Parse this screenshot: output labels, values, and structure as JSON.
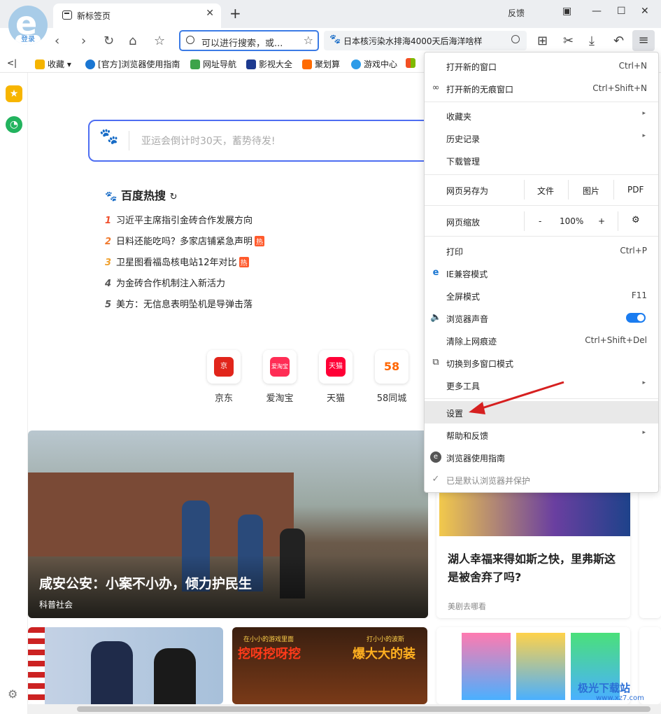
{
  "tab": {
    "title": "新标签页"
  },
  "window": {
    "feedback": "反馈",
    "close": "✕",
    "min": "—",
    "max": "☐"
  },
  "account": {
    "login": "登录"
  },
  "address": {
    "placeholder": "可以进行搜索，或..."
  },
  "search_suggest": {
    "text": "日本核污染水排海4000天后海洋啥样"
  },
  "bookmarks": {
    "collapse": "<|",
    "items": [
      "收藏",
      "[官方]浏览器使用指南",
      "网址导航",
      "影视大全",
      "聚划算",
      "游戏中心"
    ]
  },
  "baidu": {
    "placeholder": "亚运会倒计时30天，蓄势待发!",
    "hot_title": "百度热搜",
    "hot_items": [
      {
        "rank": "1",
        "text": "习近平主席指引金砖合作发展方向",
        "tag": ""
      },
      {
        "rank": "2",
        "text": "日料还能吃吗？多家店铺紧急声明",
        "tag": "热"
      },
      {
        "rank": "3",
        "text": "卫星图看福岛核电站12年对比",
        "tag": "热"
      },
      {
        "rank": "4",
        "text": "为金砖合作机制注入新活力",
        "tag": ""
      },
      {
        "rank": "5",
        "text": "美方：无信息表明坠机是导弹击落",
        "tag": ""
      }
    ]
  },
  "apps": [
    {
      "label": "京东",
      "color": "#e1251b",
      "glyph": "京"
    },
    {
      "label": "爱淘宝",
      "color": "#ff2d55",
      "glyph": "爱淘宝"
    },
    {
      "label": "天猫",
      "color": "#ff0036",
      "glyph": "天猫"
    },
    {
      "label": "58同城",
      "color": "#ffffff",
      "glyph": "58"
    }
  ],
  "news": {
    "main_title": "咸安公安：小案不小办，倾力护民生",
    "main_source": "科普社会",
    "side_title": "湖人幸福来得如斯之快，里弗斯这是被舍弃了吗?",
    "side_source": "美剧去哪看",
    "game_banner_left": "在小小的游戏里面",
    "game_banner_right": "打小小的波斯",
    "game_big_left": "挖呀挖呀挖",
    "game_big_right": "爆大大的装"
  },
  "menu": {
    "new_window": "打开新的窗口",
    "new_window_key": "Ctrl+N",
    "incognito": "打开新的无痕窗口",
    "incognito_key": "Ctrl+Shift+N",
    "favorites": "收藏夹",
    "history": "历史记录",
    "downloads": "下载管理",
    "save_as": "网页另存为",
    "save_file": "文件",
    "save_image": "图片",
    "save_pdf": "PDF",
    "zoom": "网页缩放",
    "zoom_minus": "-",
    "zoom_value": "100%",
    "zoom_plus": "+",
    "print": "打印",
    "print_key": "Ctrl+P",
    "ie_mode": "IE兼容模式",
    "fullscreen": "全屏模式",
    "fullscreen_key": "F11",
    "sound": "浏览器声音",
    "clear": "清除上网痕迹",
    "clear_key": "Ctrl+Shift+Del",
    "multi_window": "切换到多窗口模式",
    "more_tools": "更多工具",
    "settings": "设置",
    "help": "帮助和反馈",
    "guide": "浏览器使用指南",
    "default_browser": "已是默认浏览器并保护"
  },
  "watermark": {
    "text": "极光下载站",
    "url": "www.xz7.com"
  },
  "colors": {
    "accent": "#3b7be5",
    "menu_highlight": "#e9e9e9",
    "toggle": "#1a7cf0",
    "arrow": "#d62020"
  }
}
